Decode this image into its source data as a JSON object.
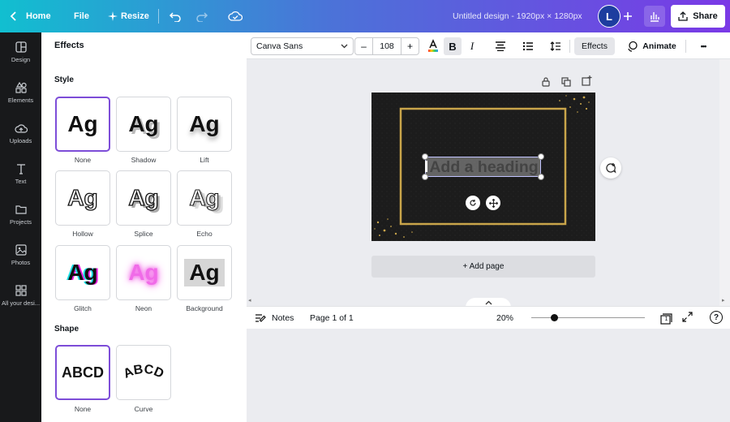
{
  "topbar": {
    "home_label": "Home",
    "file_label": "File",
    "resize_label": "Resize",
    "title": "Untitled design - 1920px × 1280px",
    "avatar_letter": "L",
    "share_label": "Share"
  },
  "leftnav": {
    "items": [
      {
        "label": "Design",
        "icon": "layout-icon"
      },
      {
        "label": "Elements",
        "icon": "shapes-icon"
      },
      {
        "label": "Uploads",
        "icon": "cloud-upload-icon"
      },
      {
        "label": "Text",
        "icon": "text-icon"
      },
      {
        "label": "Projects",
        "icon": "folder-icon"
      },
      {
        "label": "Photos",
        "icon": "image-icon"
      },
      {
        "label": "All your desi...",
        "icon": "apps-grid-icon"
      }
    ]
  },
  "panel": {
    "title": "Effects",
    "style_heading": "Style",
    "shape_heading": "Shape",
    "sample_text": "Ag",
    "shape_sample": "ABCD",
    "styles": [
      "None",
      "Shadow",
      "Lift",
      "Hollow",
      "Splice",
      "Echo",
      "Glitch",
      "Neon",
      "Background"
    ],
    "shapes": [
      "None",
      "Curve"
    ],
    "selected_style": "None",
    "selected_shape": "None"
  },
  "toolbar": {
    "font_family": "Canva Sans",
    "minus": "–",
    "font_size": "108",
    "plus": "+",
    "bold": "B",
    "italic": "I",
    "effects_label": "Effects",
    "animate_label": "Animate",
    "more": "•••"
  },
  "canvas": {
    "heading_text": "Add a heading",
    "add_page_label": "+ Add page",
    "accent_gold": "#c9a54a",
    "background": "#1a1a1a"
  },
  "bottombar": {
    "notes_label": "Notes",
    "page_indicator": "Page 1 of 1",
    "zoom": "20%",
    "zoom_fraction": 0.2,
    "pages_count": "1",
    "help": "?"
  }
}
